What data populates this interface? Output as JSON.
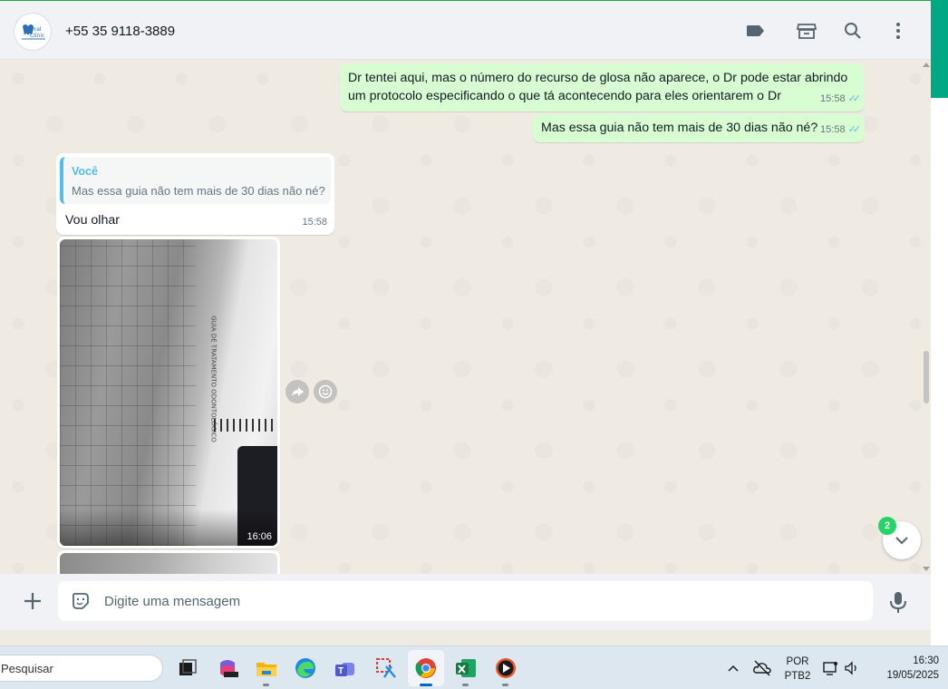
{
  "header": {
    "contact_name": "+55 35 9118-3889",
    "avatar_text": "Oral Clinic",
    "icons": [
      "label-icon",
      "catalog-icon",
      "search-icon",
      "menu-icon"
    ]
  },
  "messages": [
    {
      "direction": "out",
      "lines": [
        "Dr tentei aqui, mas o número do recurso de glosa não aparece, o Dr pode estar abrindo",
        "um protocolo especificando o que tá acontecendo para eles orientarem o Dr"
      ],
      "time": "15:58",
      "status": "read"
    },
    {
      "direction": "out",
      "text": "Mas essa guia não tem mais de 30 dias não né?",
      "time": "15:58",
      "status": "read"
    },
    {
      "direction": "in",
      "quote_author": "Você",
      "quote_text": "Mas essa guia não tem mais de 30 dias não né?",
      "text": "Vou olhar",
      "time": "15:58"
    },
    {
      "direction": "in",
      "type": "image",
      "image_text": "GUIA DE TRATAMENTO ODONTOLÓGICO",
      "time": "16:06"
    }
  ],
  "scroll_down": {
    "unread_count": "2"
  },
  "composer": {
    "placeholder": "Digite uma mensagem"
  },
  "taskbar": {
    "search_placeholder": "Pesquisar",
    "apps": [
      "task-view",
      "microsoft-365",
      "file-explorer",
      "edge",
      "teams",
      "snipping-tool",
      "chrome",
      "excel",
      "media-player"
    ],
    "language": "POR",
    "layout": "PTB2",
    "time": "16:30",
    "date": "19/05/2025"
  },
  "colors": {
    "accent": "#00a884",
    "outgoing_bubble": "#d9fdd3",
    "read_ticks": "#53bdeb",
    "badge": "#25d366"
  }
}
